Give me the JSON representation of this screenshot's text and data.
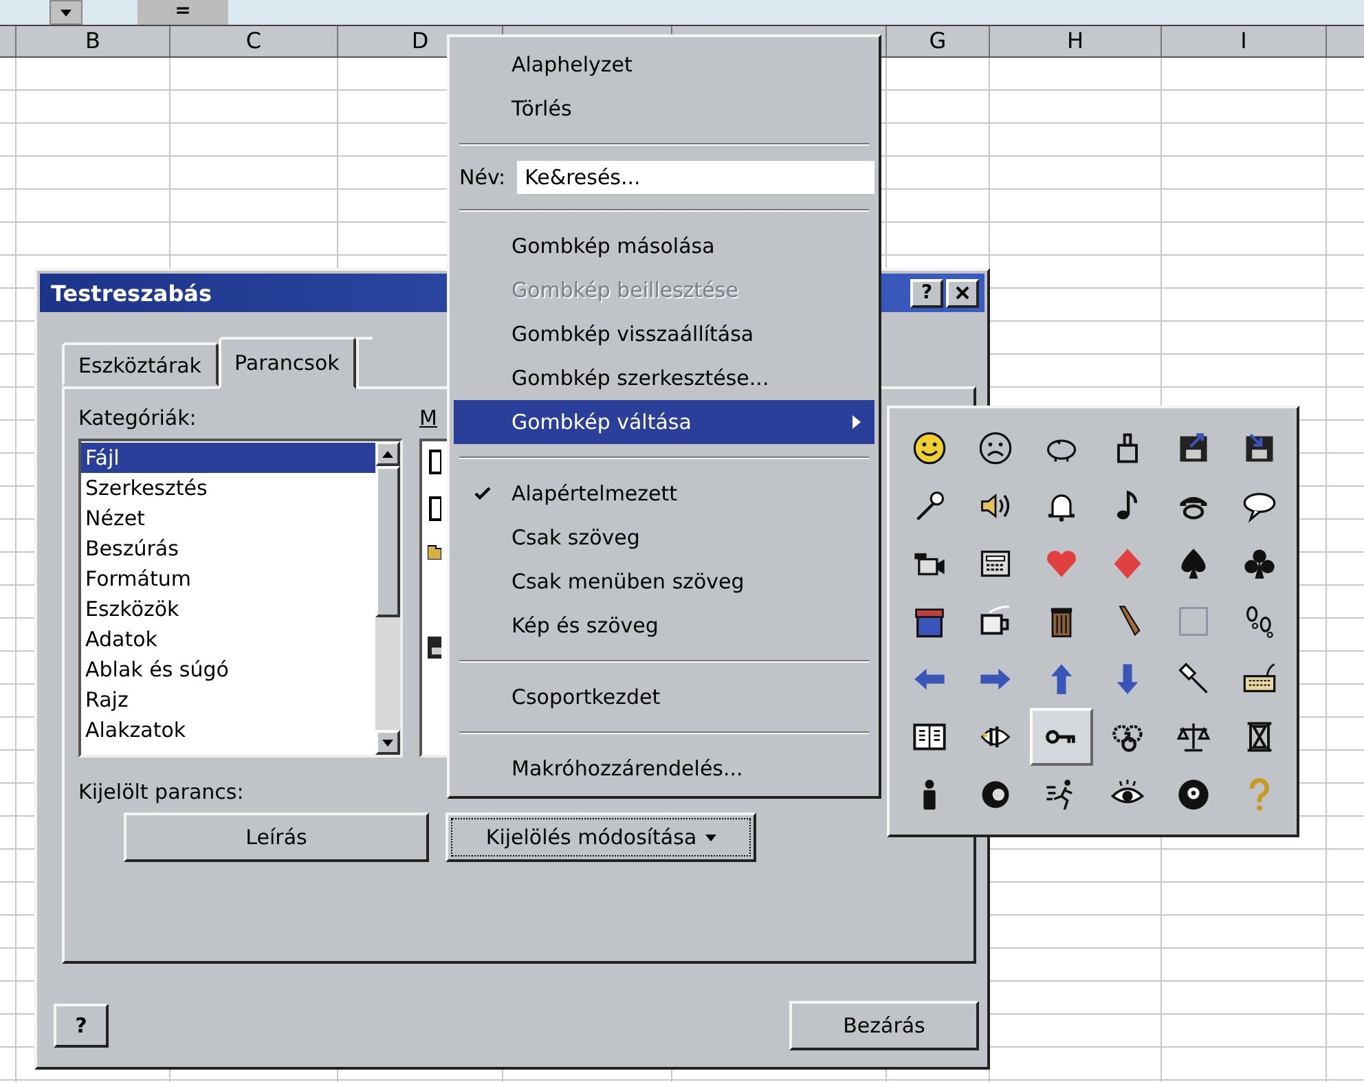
{
  "formula_bar": {
    "equals": "="
  },
  "sheet": {
    "columns": [
      "B",
      "C",
      "D",
      "G",
      "H",
      "I"
    ]
  },
  "dialog": {
    "title": "Testreszabás",
    "help_button": "?",
    "tabs": [
      {
        "label": "Eszköztárak",
        "selected": false
      },
      {
        "label": "Parancsok",
        "selected": true
      }
    ],
    "categories_label": "Kategóriák:",
    "categories": [
      {
        "label": "Fájl",
        "selected": true
      },
      {
        "label": "Szerkesztés",
        "selected": false
      },
      {
        "label": "Nézet",
        "selected": false
      },
      {
        "label": "Beszúrás",
        "selected": false
      },
      {
        "label": "Formátum",
        "selected": false
      },
      {
        "label": "Eszközök",
        "selected": false
      },
      {
        "label": "Adatok",
        "selected": false
      },
      {
        "label": "Ablak és súgó",
        "selected": false
      },
      {
        "label": "Rajz",
        "selected": false
      },
      {
        "label": "Alakzatok",
        "selected": false
      }
    ],
    "commands_label": "M",
    "selected_command_label": "Kijelölt parancs:",
    "description_button": "Leírás",
    "modify_button": "Kijelölés módosítása",
    "bottom_help_button": "?",
    "close_button": "Bezárás"
  },
  "context_menu": [
    {
      "kind": "item",
      "label": "Alaphelyzet",
      "disabled": false,
      "selected": false,
      "checked": false,
      "submenu": false
    },
    {
      "kind": "item",
      "label": "Törlés",
      "disabled": false,
      "selected": false,
      "checked": false,
      "submenu": false
    },
    {
      "kind": "separator"
    },
    {
      "kind": "name_field",
      "label": "Név:",
      "value": "Ke&resés..."
    },
    {
      "kind": "separator"
    },
    {
      "kind": "item",
      "label": "Gombkép másolása",
      "disabled": false,
      "selected": false,
      "checked": false,
      "submenu": false
    },
    {
      "kind": "item",
      "label": "Gombkép beillesztése",
      "disabled": true,
      "selected": false,
      "checked": false,
      "submenu": false
    },
    {
      "kind": "item",
      "label": "Gombkép visszaállítása",
      "disabled": false,
      "selected": false,
      "checked": false,
      "submenu": false
    },
    {
      "kind": "item",
      "label": "Gombkép szerkesztése...",
      "disabled": false,
      "selected": false,
      "checked": false,
      "submenu": false
    },
    {
      "kind": "item",
      "label": "Gombkép váltása",
      "disabled": false,
      "selected": true,
      "checked": false,
      "submenu": true
    },
    {
      "kind": "separator"
    },
    {
      "kind": "item",
      "label": "Alapértelmezett",
      "disabled": false,
      "selected": false,
      "checked": true,
      "submenu": false
    },
    {
      "kind": "item",
      "label": "Csak szöveg",
      "disabled": false,
      "selected": false,
      "checked": false,
      "submenu": false
    },
    {
      "kind": "item",
      "label": "Csak menüben szöveg",
      "disabled": false,
      "selected": false,
      "checked": false,
      "submenu": false
    },
    {
      "kind": "item",
      "label": "Kép és szöveg",
      "disabled": false,
      "selected": false,
      "checked": false,
      "submenu": false
    },
    {
      "kind": "separator"
    },
    {
      "kind": "item",
      "label": "Csoportkezdet",
      "disabled": false,
      "selected": false,
      "checked": false,
      "submenu": false
    },
    {
      "kind": "separator"
    },
    {
      "kind": "item",
      "label": "Makróhozzárendelés...",
      "disabled": false,
      "selected": false,
      "checked": false,
      "submenu": false
    }
  ],
  "button_images": [
    {
      "selected": false
    },
    {
      "selected": false
    },
    {
      "selected": false
    },
    {
      "selected": false
    },
    {
      "selected": false
    },
    {
      "selected": false
    },
    {
      "selected": false
    },
    {
      "selected": false
    },
    {
      "selected": false
    },
    {
      "selected": false
    },
    {
      "selected": false
    },
    {
      "selected": false
    },
    {
      "selected": false
    },
    {
      "selected": false
    },
    {
      "selected": false
    },
    {
      "selected": false
    },
    {
      "selected": false
    },
    {
      "selected": false
    },
    {
      "selected": false
    },
    {
      "selected": false
    },
    {
      "selected": false
    },
    {
      "selected": false
    },
    {
      "selected": false
    },
    {
      "selected": false
    },
    {
      "selected": false
    },
    {
      "selected": false
    },
    {
      "selected": false
    },
    {
      "selected": false
    },
    {
      "selected": false
    },
    {
      "selected": false
    },
    {
      "selected": false
    },
    {
      "selected": false
    },
    {
      "selected": true
    },
    {
      "selected": false
    },
    {
      "selected": false
    },
    {
      "selected": false
    },
    {
      "selected": false
    },
    {
      "selected": false
    },
    {
      "selected": false
    },
    {
      "selected": false
    },
    {
      "selected": false
    },
    {
      "selected": false
    }
  ]
}
